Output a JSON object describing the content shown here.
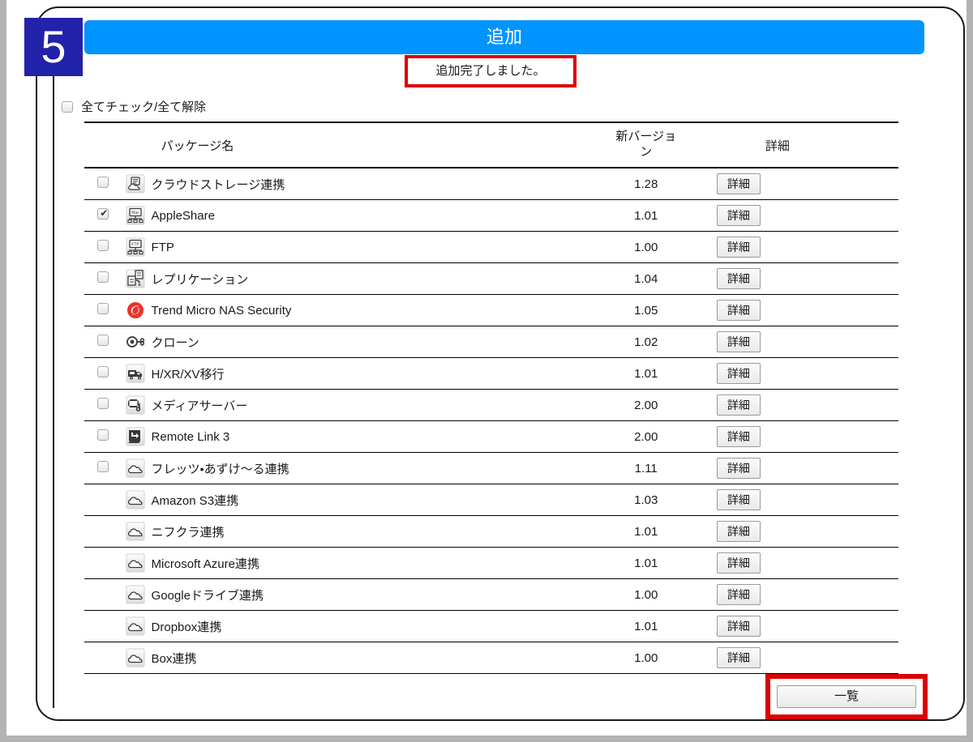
{
  "step": {
    "number": "5"
  },
  "header": {
    "title": "追加"
  },
  "notice": {
    "message": "追加完了しました。"
  },
  "select_all": {
    "label": "全てチェック/全て解除",
    "checked": false
  },
  "table": {
    "headers": {
      "package_name": "パッケージ名",
      "new_version_line1": "新バージョ",
      "new_version_line2": "ン",
      "detail": "詳細"
    },
    "detail_button_label": "詳細",
    "rows": [
      {
        "name": "クラウドストレージ連携",
        "version": "1.28",
        "icon": "cloud-storage-icon",
        "has_checkbox": true,
        "checked": false,
        "detail": "詳細"
      },
      {
        "name": "AppleShare",
        "version": "1.01",
        "icon": "mac-share-icon",
        "has_checkbox": true,
        "checked": true,
        "detail": "詳細"
      },
      {
        "name": "FTP",
        "version": "1.00",
        "icon": "ftp-share-icon",
        "has_checkbox": true,
        "checked": false,
        "detail": "詳細"
      },
      {
        "name": "レプリケーション",
        "version": "1.04",
        "icon": "replication-icon",
        "has_checkbox": true,
        "checked": false,
        "detail": "詳細"
      },
      {
        "name": "Trend Micro NAS Security",
        "version": "1.05",
        "icon": "trend-micro-icon",
        "has_checkbox": true,
        "checked": false,
        "detail": "詳細"
      },
      {
        "name": "クローン",
        "version": "1.02",
        "icon": "clone-key-icon",
        "has_checkbox": true,
        "checked": false,
        "detail": "詳細"
      },
      {
        "name": "H/XR/XV移行",
        "version": "1.01",
        "icon": "migration-truck-icon",
        "has_checkbox": true,
        "checked": false,
        "detail": "詳細"
      },
      {
        "name": "メディアサーバー",
        "version": "2.00",
        "icon": "media-server-icon",
        "has_checkbox": true,
        "checked": false,
        "detail": "詳細"
      },
      {
        "name": "Remote Link 3",
        "version": "2.00",
        "icon": "remote-link-icon",
        "has_checkbox": true,
        "checked": false,
        "detail": "詳細"
      },
      {
        "name": "フレッツ・あずけ〜る連携",
        "version": "1.11",
        "icon": "cloud-icon",
        "has_checkbox": true,
        "checked": false,
        "detail": "詳細"
      },
      {
        "name": "Amazon S3連携",
        "version": "1.03",
        "icon": "cloud-icon",
        "has_checkbox": false,
        "checked": false,
        "detail": "詳細"
      },
      {
        "name": "ニフクラ連携",
        "version": "1.01",
        "icon": "cloud-icon",
        "has_checkbox": false,
        "checked": false,
        "detail": "詳細"
      },
      {
        "name": "Microsoft Azure連携",
        "version": "1.01",
        "icon": "cloud-icon",
        "has_checkbox": false,
        "checked": false,
        "detail": "詳細"
      },
      {
        "name": "Googleドライブ連携",
        "version": "1.00",
        "icon": "cloud-icon",
        "has_checkbox": false,
        "checked": false,
        "detail": "詳細"
      },
      {
        "name": "Dropbox連携",
        "version": "1.01",
        "icon": "cloud-icon",
        "has_checkbox": false,
        "checked": false,
        "detail": "詳細"
      },
      {
        "name": "Box連携",
        "version": "1.00",
        "icon": "cloud-icon",
        "has_checkbox": false,
        "checked": false,
        "detail": "詳細"
      }
    ]
  },
  "footer": {
    "list_button_label": "一覧"
  },
  "colors": {
    "step_badge": "#2222aa",
    "header_bar": "#0094ff",
    "highlight_red": "#dd0000",
    "text": "#1a1a1a",
    "frame": "#1a1a1a",
    "page_background": "#b3b3b3"
  }
}
